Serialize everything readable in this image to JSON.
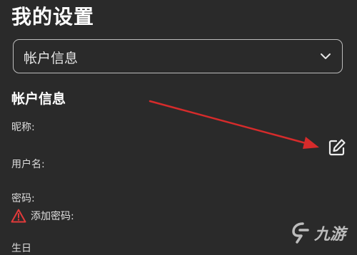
{
  "page": {
    "title": "我的设置"
  },
  "section_select": {
    "value": "帐户信息"
  },
  "account": {
    "heading": "帐户信息",
    "nickname_label": "昵称:",
    "username_label": "用户名:",
    "password_label": "密码:",
    "add_password_label": "添加密码:",
    "birthday_label_partial": "生日"
  },
  "icons": {
    "dropdown": "chevron-down-icon",
    "edit": "edit-icon",
    "warning": "warning-triangle-icon"
  },
  "annotation": {
    "arrow_color": "#d62b2b"
  },
  "watermark": {
    "text": "九游"
  },
  "colors": {
    "background": "#2a2a2a",
    "text": "#e8e8e8",
    "warning": "#e23a3a"
  }
}
